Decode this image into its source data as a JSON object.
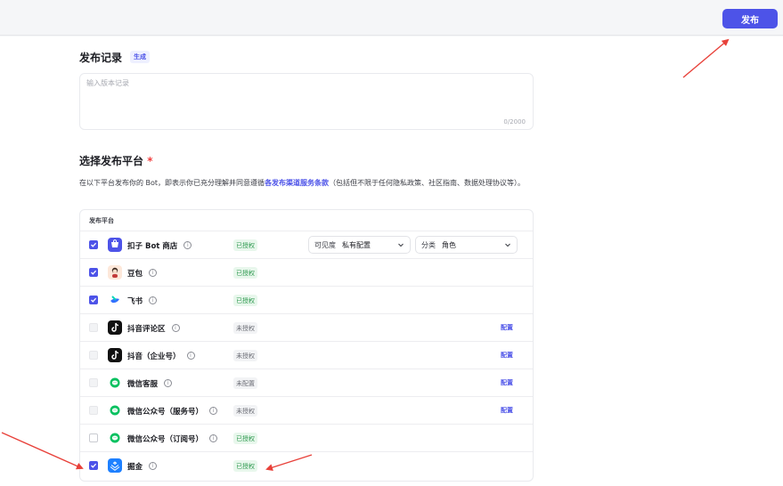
{
  "header": {
    "publish_label": "发布"
  },
  "record": {
    "title": "发布记录",
    "generate_label": "生成",
    "placeholder": "输入版本记录",
    "counter": "0/2000"
  },
  "platforms_section": {
    "title": "选择发布平台",
    "required_mark": "*",
    "desc_prefix": "在以下平台发布你的 Bot，即表示你已充分理解并同意遵循",
    "desc_terms": "各发布渠道服务条款",
    "desc_suffix": "（包括但不限于任何隐私政策、社区指南、数据处理协议等）。",
    "table_header": "发布平台",
    "visibility": {
      "label": "可见度",
      "value": "私有配置"
    },
    "category": {
      "label": "分类",
      "value": "角色"
    },
    "rows": [
      {
        "name": "扣子 Bot 商店",
        "status": "已授权",
        "checked": true,
        "disabled": false,
        "config": "",
        "icon": "coze-store-icon",
        "color": "#4d53e8"
      },
      {
        "name": "豆包",
        "status": "已授权",
        "checked": true,
        "disabled": false,
        "config": "",
        "icon": "doubao-icon",
        "color": "#f0c8a8"
      },
      {
        "name": "飞书",
        "status": "已授权",
        "checked": true,
        "disabled": false,
        "config": "",
        "icon": "feishu-icon",
        "color": "#3370ff"
      },
      {
        "name": "抖音评论区",
        "status": "未授权",
        "checked": false,
        "disabled": true,
        "config": "配置",
        "icon": "douyin-icon",
        "color": "#111111"
      },
      {
        "name": "抖音（企业号）",
        "status": "未授权",
        "checked": false,
        "disabled": true,
        "config": "配置",
        "icon": "douyin-icon",
        "color": "#111111"
      },
      {
        "name": "微信客服",
        "status": "未配置",
        "checked": false,
        "disabled": true,
        "config": "配置",
        "icon": "wechat-icon",
        "color": "#07c160"
      },
      {
        "name": "微信公众号（服务号）",
        "status": "未授权",
        "checked": false,
        "disabled": true,
        "config": "配置",
        "icon": "wechat-icon",
        "color": "#07c160"
      },
      {
        "name": "微信公众号（订阅号）",
        "status": "已授权",
        "checked": false,
        "disabled": false,
        "config": "",
        "icon": "wechat-icon",
        "color": "#07c160"
      },
      {
        "name": "掘金",
        "status": "已授权",
        "checked": true,
        "disabled": false,
        "config": "",
        "icon": "juejin-icon",
        "color": "#1e80ff"
      }
    ]
  },
  "annotation_color": "#e8413a"
}
